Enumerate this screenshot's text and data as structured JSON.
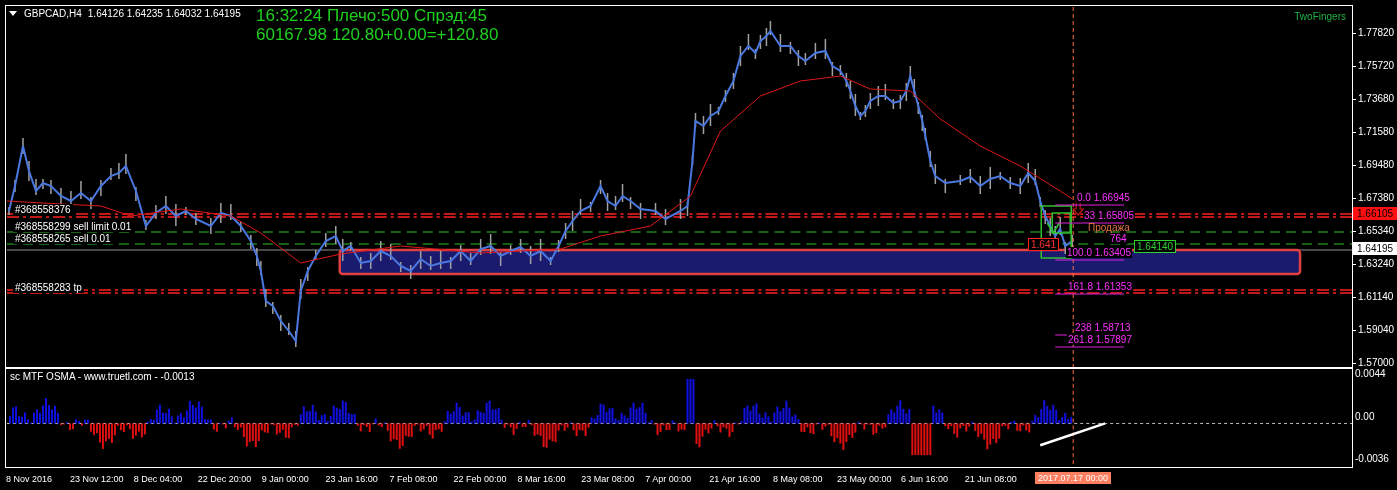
{
  "chart_header": {
    "symbol": "GBPCAD,H4",
    "quotes": "1.64126 1.64235 1.64032 1.64195"
  },
  "info": {
    "line_1": "16:32:24 Плечо:500 Спрэд:45",
    "line_2": "60167.98 120.80+0.00=+120.80"
  },
  "indicator_label": "TwoFingers",
  "order_labels": [
    "#368558376",
    "#368558299 sell limit 0.01",
    "#368558265 sell 0.01",
    "#368558283 tp"
  ],
  "fib_labels": [
    "0.0 1.66945",
    "33 1.65805",
    "764",
    "100.0 1.63405",
    "161.8 1.61353",
    "238 1.58713",
    "261.8 1.57897"
  ],
  "trade_labels": {
    "signal": "Продажа",
    "entry_price": "1.641",
    "target_price": "1.64140"
  },
  "price_axis": {
    "ticks": [
      "1.77820",
      "1.75720",
      "1.73680",
      "1.71580",
      "1.69480",
      "1.67380",
      "1.65340",
      "1.63240",
      "1.61140",
      "1.59040",
      "1.57000"
    ],
    "order_price": "1.66105",
    "current_price": "1.64195"
  },
  "oscillator": {
    "title": "sc MTF OSMA - www.truetl.com - -0.0013",
    "ticks": [
      "0.0044",
      "0.00",
      "-0.0036"
    ]
  },
  "time_axis": {
    "ticks": [
      "8 Nov 2016",
      "23 Nov 12:00",
      "8 Dec 04:00",
      "22 Dec 20:00",
      "9 Jan 00:00",
      "23 Jan 16:00",
      "7 Feb 08:00",
      "22 Feb 00:00",
      "8 Mar 16:00",
      "23 Mar 08:00",
      "7 Apr 00:00",
      "21 Apr 16:00",
      "8 May 08:00",
      "23 May 00:00",
      "6 Jun 16:00",
      "21 Jun 08:00"
    ],
    "cursor_label": "2017.07.17 00:00"
  }
}
